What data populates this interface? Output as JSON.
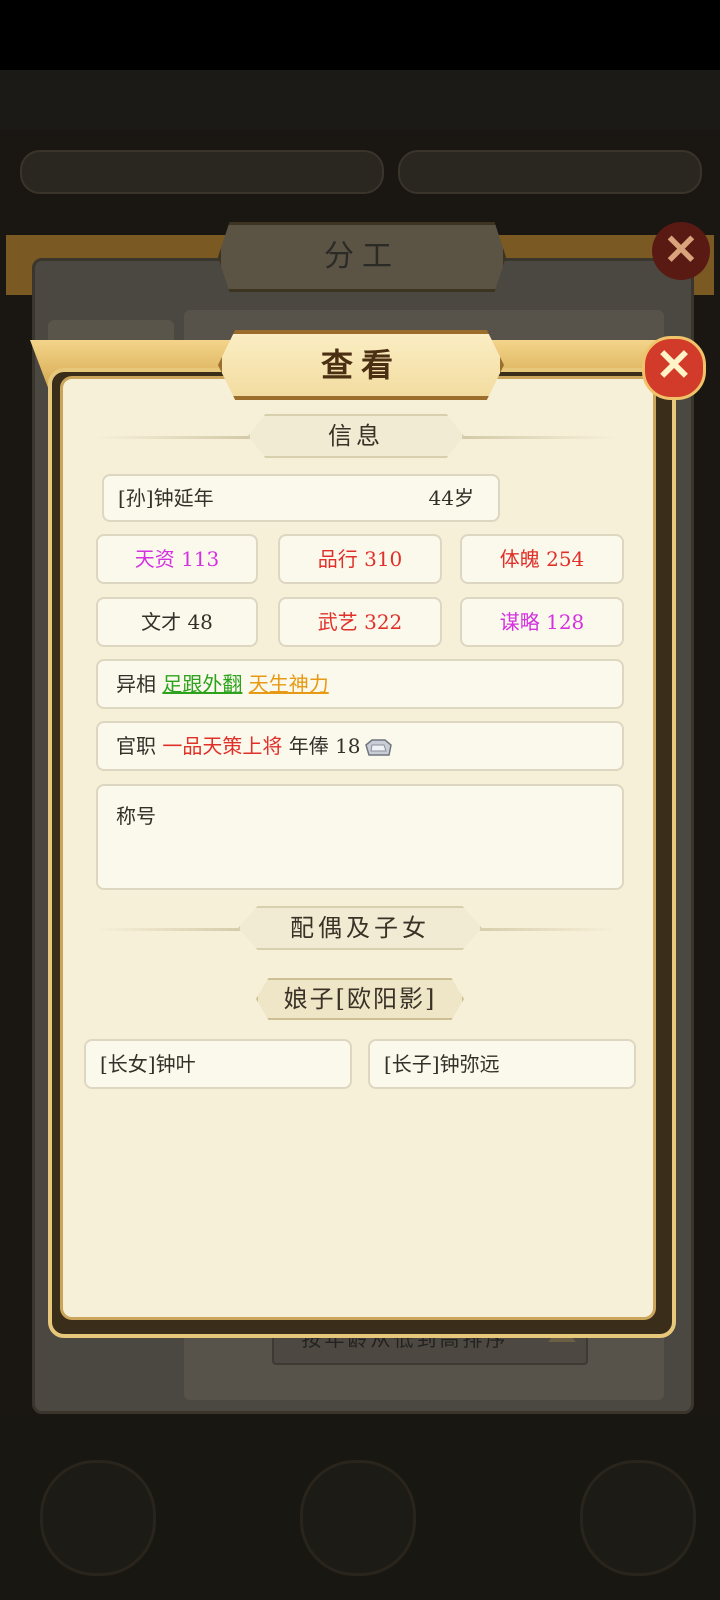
{
  "background_dialog": {
    "title": "分工",
    "close_icon": "close-x-icon",
    "sort_button_label": "按年龄从低到高排序"
  },
  "dialog": {
    "title": "查看",
    "close_icon": "close-x-icon"
  },
  "info_section": {
    "header": "信息",
    "person": {
      "name": "[孙]钟延年",
      "age": "44岁"
    },
    "stats": [
      {
        "label": "天资 113",
        "color": "#d431e0"
      },
      {
        "label": "品行 310",
        "color": "#e0302a"
      },
      {
        "label": "体魄 254",
        "color": "#e0302a"
      },
      {
        "label": "文才 48",
        "color": "#33302a"
      },
      {
        "label": "武艺 322",
        "color": "#e0302a"
      },
      {
        "label": "谋略 128",
        "color": "#d431e0"
      }
    ],
    "traits": {
      "label": "异相",
      "items": [
        "足跟外翻",
        "天生神力"
      ]
    },
    "office": {
      "label": "官职",
      "position": "一品天策上将",
      "salary_label": "年俸",
      "salary_value": "18",
      "salary_icon": "silver-ingot-icon"
    },
    "title_field": {
      "label": "称号",
      "value": ""
    }
  },
  "family_section": {
    "header": "配偶及子女",
    "spouse": "娘子[欧阳影]",
    "children": [
      "[长女]钟叶",
      "[长子]钟弥远"
    ]
  }
}
